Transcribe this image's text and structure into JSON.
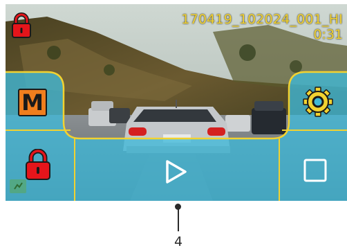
{
  "playback": {
    "filename": "170419_102024_001_HI",
    "elapsed": "0:31"
  },
  "controls": {
    "mode_label": "M"
  },
  "callout": {
    "number": "4"
  },
  "colors": {
    "accent_yellow": "#f2d230",
    "overlay_blue": "#3fb8d8",
    "lock_red": "#e5151b",
    "mode_orange": "#f07e1e"
  },
  "icons": [
    "lock-icon",
    "gear-icon",
    "play-icon",
    "stop-icon",
    "mode-icon",
    "parking-icon"
  ]
}
